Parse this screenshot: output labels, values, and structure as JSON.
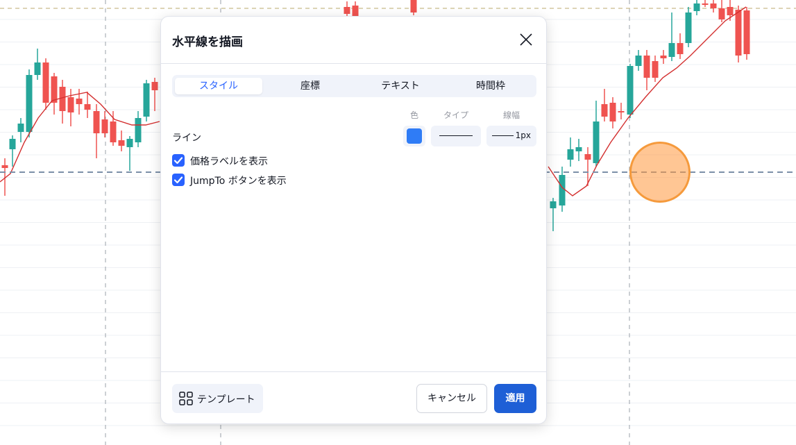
{
  "chart": {
    "up_color": "#26a69a",
    "down_color": "#ef5350",
    "ma_color": "#d32f2f",
    "hline_color": "#7b8fa8"
  },
  "dialog": {
    "title": "水平線を描画",
    "tabs": [
      {
        "label": "スタイル",
        "active": true
      },
      {
        "label": "座標",
        "active": false
      },
      {
        "label": "テキスト",
        "active": false
      },
      {
        "label": "時間枠",
        "active": false
      }
    ],
    "columns": {
      "color": "色",
      "type": "タイプ",
      "width": "線幅"
    },
    "line_row": {
      "label": "ライン",
      "color": "#2f7cf6",
      "width_value": "1px"
    },
    "checkboxes": [
      {
        "label": "価格ラベルを表示",
        "checked": true
      },
      {
        "label": "JumpTo ボタンを表示",
        "checked": true
      }
    ],
    "footer": {
      "template_label": "テンプレート",
      "cancel_label": "キャンセル",
      "apply_label": "適用"
    }
  }
}
